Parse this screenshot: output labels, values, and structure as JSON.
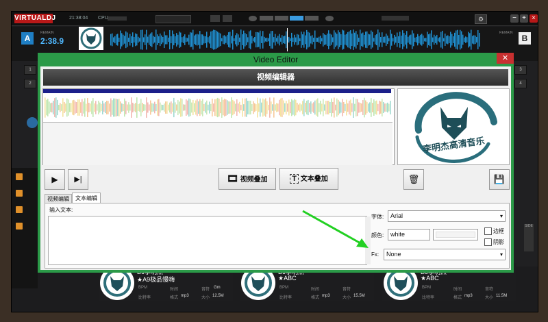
{
  "vdj": {
    "logo": "VIRTUALDJ",
    "clock": "21:38:04",
    "cpu_label": "CPU",
    "deckA": {
      "label": "A",
      "remain_label": "REMAIN",
      "time": "2:38.9"
    },
    "deckB": {
      "label": "B",
      "remain_label": "REMAIN"
    },
    "side_buttons_left": [
      "1",
      "2"
    ],
    "side_buttons_right": [
      "3",
      "4"
    ],
    "browser_strip": "SIDE"
  },
  "cards": [
    {
      "artist": "DJ李明杰",
      "title": "★A9极品慢嗨",
      "bpm": "BPM",
      "time_label": "时间",
      "key_label": "音符",
      "key": "Gm",
      "bitrate_label": "比特率",
      "format_label": "格式",
      "format": "mp3",
      "size_label": "大小",
      "size": "12.5M"
    },
    {
      "artist": "DJ李明杰",
      "title": "★ABC",
      "bpm": "BPM",
      "time_label": "时间",
      "key_label": "音符",
      "key": "",
      "bitrate_label": "比特率",
      "format_label": "格式",
      "format": "mp3",
      "size_label": "大小",
      "size": "15.5M"
    },
    {
      "artist": "DJ李明杰",
      "title": "★ABC",
      "bpm": "BPM",
      "time_label": "时间",
      "key_label": "音符",
      "key": "",
      "bitrate_label": "比特率",
      "format_label": "格式",
      "format": "mp3",
      "size_label": "大小",
      "size": "11.5M"
    }
  ],
  "editor": {
    "window_title": "Video Editor",
    "close_glyph": "✕",
    "header": "视频编辑器",
    "logo_text": "李明杰高清音乐",
    "video_add_label": "视频叠加",
    "text_add_label": "文本叠加",
    "tabs": [
      "视频编辑",
      "文本编辑"
    ],
    "input_text_label": "输入文本:",
    "font_label": "字体:",
    "font_value": "Arial",
    "color_label": "颜色:",
    "color_value": "white",
    "border_label": "边框",
    "shadow_label": "阴影",
    "fx_label": "Fx:",
    "fx_value": "None"
  },
  "colors": {
    "dialog_green": "#2b9a48",
    "annotation_arrow": "#22d022",
    "deck_blue": "#1f7fc4",
    "close_red": "#c83030"
  }
}
